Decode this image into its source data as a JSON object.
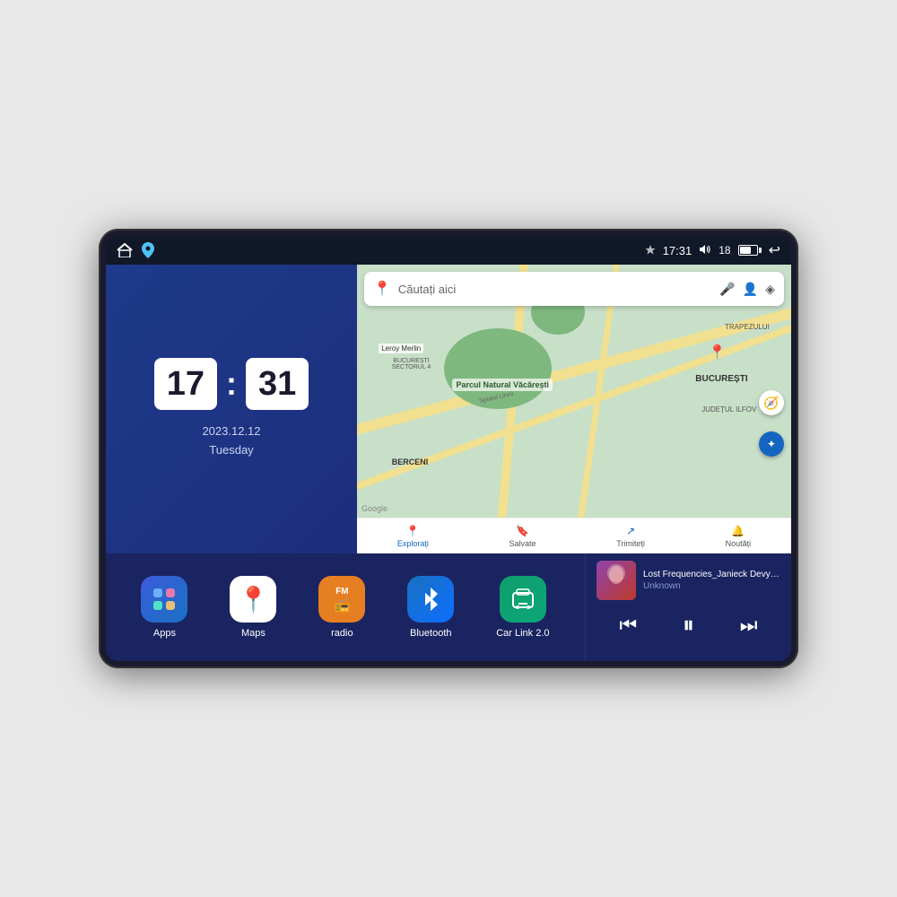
{
  "device": {
    "screen": {
      "status_bar": {
        "left_icons": [
          "home",
          "maps-pin"
        ],
        "time": "17:31",
        "signal": "18",
        "battery": "60",
        "nav_back": "↩"
      },
      "clock": {
        "hours": "17",
        "minutes": "31",
        "date": "2023.12.12",
        "day": "Tuesday"
      },
      "map": {
        "search_placeholder": "Căutați aici",
        "labels": {
          "parcul": "Parcul Natural Văcărești",
          "leroy": "Leroy Merlin",
          "berceni": "BERCENI",
          "bucuresti": "BUCUREȘTI",
          "ilfov": "JUDEȚUL ILFOV",
          "trapez": "TRAPEZULUI",
          "splai": "Splaiul Unirii",
          "sector": "BUCUREȘTI\nSECTORUL 4"
        },
        "bottom_nav": [
          {
            "icon": "📍",
            "label": "Explorați"
          },
          {
            "icon": "🔖",
            "label": "Salvate"
          },
          {
            "icon": "↗",
            "label": "Trimiteți"
          },
          {
            "icon": "🔔",
            "label": "Noutăți"
          }
        ]
      },
      "apps": [
        {
          "id": "apps",
          "label": "Apps",
          "icon_type": "grid"
        },
        {
          "id": "maps",
          "label": "Maps",
          "icon_type": "maps"
        },
        {
          "id": "radio",
          "label": "radio",
          "icon_type": "radio"
        },
        {
          "id": "bluetooth",
          "label": "Bluetooth",
          "icon_type": "bluetooth"
        },
        {
          "id": "carlink",
          "label": "Car Link 2.0",
          "icon_type": "carlink"
        }
      ],
      "music": {
        "title": "Lost Frequencies_Janieck Devy-...",
        "artist": "Unknown",
        "controls": {
          "prev": "⏮",
          "play": "⏸",
          "next": "⏭"
        }
      }
    }
  }
}
